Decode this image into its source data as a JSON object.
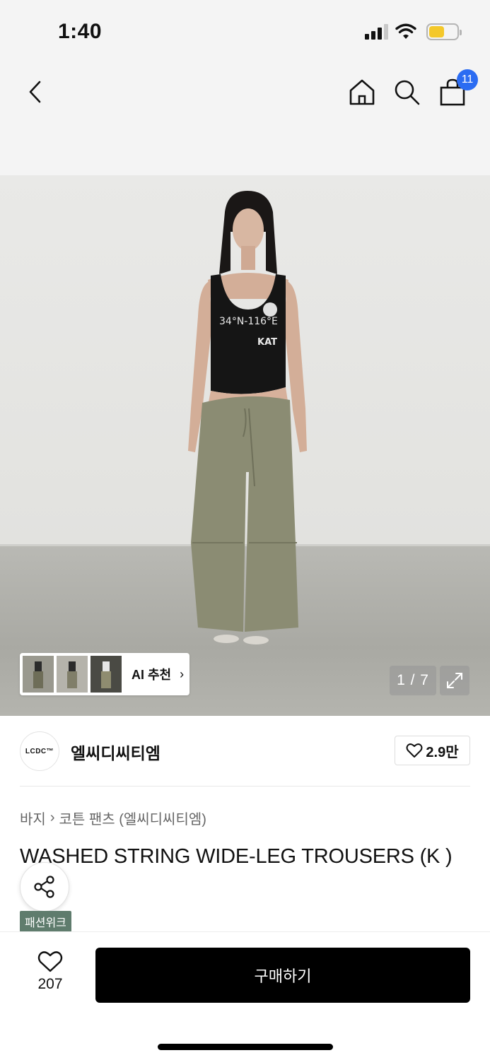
{
  "status_bar": {
    "time": "1:40"
  },
  "nav": {
    "cart_count": "11",
    "icons": [
      "chevron-left-icon",
      "home-icon",
      "search-icon",
      "shopping-bag-icon"
    ]
  },
  "product_image": {
    "tank_text_line1": "34°N-116°E",
    "tank_text_line2": "KAT",
    "ai_label": "AI 추천",
    "ai_chevron": "›",
    "page_counter": "1 / 7"
  },
  "brand": {
    "logo_text": "LCDC™",
    "name": "엘씨디씨티엠",
    "like_count": "2.9만"
  },
  "breadcrumb": {
    "category": "바지",
    "separator": "›",
    "subcategory": "코튼 팬츠 (엘씨디씨티엠)"
  },
  "product": {
    "title": "WASHED STRING WIDE-LEG TROUSERS (K  )",
    "badge": "패션위크"
  },
  "bottom_bar": {
    "wish_count": "207",
    "buy_label": "구매하기"
  },
  "colors": {
    "badge_blue": "#2b6cf2",
    "event_green": "#5f7c6d",
    "buy_black": "#000000"
  }
}
